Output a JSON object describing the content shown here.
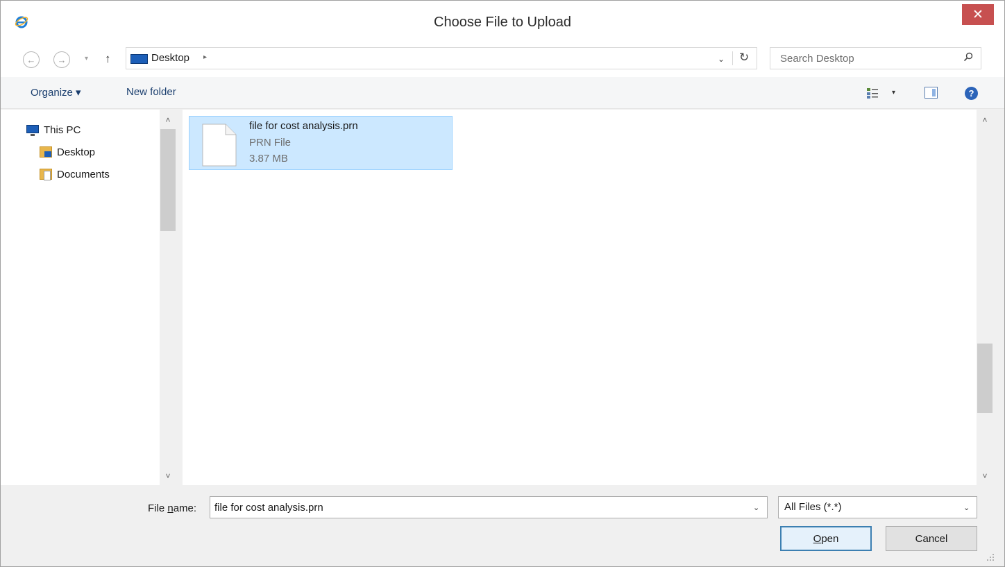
{
  "window": {
    "title": "Choose File to Upload",
    "close_glyph": "✕",
    "app_icon": "ie-icon"
  },
  "navigation": {
    "back_glyph": "←",
    "forward_glyph": "→",
    "recent_glyph": "▾",
    "up_glyph": "↑",
    "address": {
      "segment": "Desktop",
      "separator": "▸",
      "dropdown_glyph": "⌄",
      "refresh_glyph": "↻"
    },
    "search": {
      "placeholder": "Search Desktop"
    }
  },
  "toolbar": {
    "organize_label": "Organize ▾",
    "new_folder_label": "New folder",
    "views_arrow": "▾",
    "help_glyph": "?"
  },
  "sidebar": {
    "items": [
      {
        "label": "This PC",
        "icon": "computer-icon"
      },
      {
        "label": "Desktop",
        "icon": "desktop-folder-icon"
      },
      {
        "label": "Documents",
        "icon": "documents-folder-icon"
      }
    ]
  },
  "scroll": {
    "up_glyph": "˄",
    "down_glyph": "˅"
  },
  "files": [
    {
      "name": "file for cost analysis.prn",
      "type": "PRN File",
      "size": "3.87 MB",
      "selected": true
    }
  ],
  "bottom": {
    "file_name_label_prefix": "File ",
    "file_name_label_accel": "n",
    "file_name_label_suffix": "ame:",
    "file_name_value": "file for cost analysis.prn",
    "combo_arrow": "⌄",
    "filter_value": "All Files (*.*)",
    "open_label_accel": "O",
    "open_label_rest": "pen",
    "cancel_label": "Cancel"
  },
  "colors": {
    "close_button": "#c75050",
    "selection_fill": "#cce8ff",
    "selection_border": "#99d1ff",
    "default_button_border": "#3c7fb1"
  }
}
